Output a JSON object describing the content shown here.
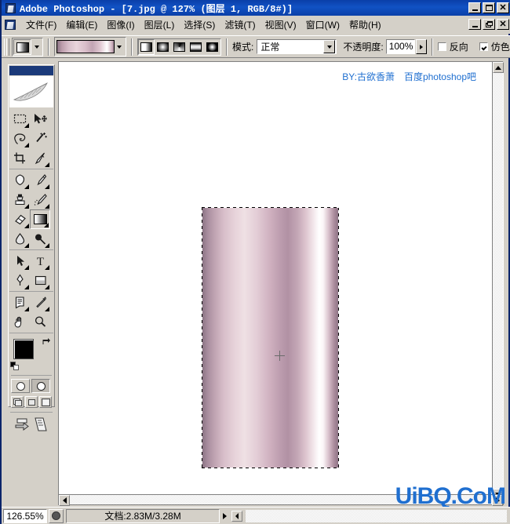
{
  "window": {
    "app_title": "Adobe Photoshop - [7.jpg @ 127% (图层 1, RGB/8#)]",
    "minimize_label": "_",
    "maximize_label": "□",
    "close_label": "✕",
    "doc_minimize_label": "_",
    "doc_restore_label": "❐",
    "doc_close_label": "✕",
    "app_icon": "photoshop-icon",
    "doc_icon": "document-icon"
  },
  "menubar": {
    "items": [
      {
        "label": "文件(F)",
        "name": "menu-file"
      },
      {
        "label": "编辑(E)",
        "name": "menu-edit"
      },
      {
        "label": "图像(I)",
        "name": "menu-image"
      },
      {
        "label": "图层(L)",
        "name": "menu-layer"
      },
      {
        "label": "选择(S)",
        "name": "menu-select"
      },
      {
        "label": "滤镜(T)",
        "name": "menu-filter"
      },
      {
        "label": "视图(V)",
        "name": "menu-view"
      },
      {
        "label": "窗口(W)",
        "name": "menu-window"
      },
      {
        "label": "帮助(H)",
        "name": "menu-help"
      }
    ]
  },
  "options_bar": {
    "tool_preset_icon": "gradient-tool-icon",
    "gradient_picker_label": "gradient-preview",
    "gradient_types": [
      {
        "name": "linear-gradient-button",
        "label": "线性渐变",
        "selected": true
      },
      {
        "name": "radial-gradient-button",
        "label": "径向渐变",
        "selected": false
      },
      {
        "name": "angle-gradient-button",
        "label": "角度渐变",
        "selected": false
      },
      {
        "name": "reflected-gradient-button",
        "label": "对称渐变",
        "selected": false
      },
      {
        "name": "diamond-gradient-button",
        "label": "菱形渐变",
        "selected": false
      }
    ],
    "mode_label": "模式:",
    "mode_value": "正常",
    "opacity_label": "不透明度:",
    "opacity_value": "100%",
    "reverse_label": "反向",
    "reverse_checked": false,
    "dither_label": "仿色",
    "dither_checked": true
  },
  "tools": {
    "groups": [
      {
        "rows": [
          {
            "cells": [
              {
                "name": "tool-marquee",
                "label": "矩形选框工具",
                "icon": "marquee-icon",
                "has_flyout": true,
                "selected": false
              },
              {
                "name": "tool-move",
                "label": "移动工具",
                "icon": "move-icon",
                "has_flyout": false,
                "selected": false
              }
            ]
          },
          {
            "cells": [
              {
                "name": "tool-lasso",
                "label": "套索工具",
                "icon": "lasso-icon",
                "has_flyout": true,
                "selected": false
              },
              {
                "name": "tool-magic-wand",
                "label": "魔棒工具",
                "icon": "magic-wand-icon",
                "has_flyout": false,
                "selected": false
              }
            ]
          },
          {
            "cells": [
              {
                "name": "tool-crop",
                "label": "裁切工具",
                "icon": "crop-icon",
                "has_flyout": false,
                "selected": false
              },
              {
                "name": "tool-slice",
                "label": "切片工具",
                "icon": "slice-icon",
                "has_flyout": true,
                "selected": false
              }
            ]
          }
        ]
      },
      {
        "rows": [
          {
            "cells": [
              {
                "name": "tool-healing-brush",
                "label": "修复画笔工具",
                "icon": "healing-brush-icon",
                "has_flyout": true,
                "selected": false
              },
              {
                "name": "tool-brush",
                "label": "画笔工具",
                "icon": "brush-icon",
                "has_flyout": true,
                "selected": false
              }
            ]
          },
          {
            "cells": [
              {
                "name": "tool-clone-stamp",
                "label": "仿制图章工具",
                "icon": "clone-stamp-icon",
                "has_flyout": true,
                "selected": false
              },
              {
                "name": "tool-history-brush",
                "label": "历史记录画笔工具",
                "icon": "history-brush-icon",
                "has_flyout": true,
                "selected": false
              }
            ]
          },
          {
            "cells": [
              {
                "name": "tool-eraser",
                "label": "橡皮擦工具",
                "icon": "eraser-icon",
                "has_flyout": true,
                "selected": false
              },
              {
                "name": "tool-gradient",
                "label": "渐变工具",
                "icon": "gradient-icon",
                "has_flyout": true,
                "selected": true
              }
            ]
          },
          {
            "cells": [
              {
                "name": "tool-blur",
                "label": "模糊工具",
                "icon": "blur-drop-icon",
                "has_flyout": true,
                "selected": false
              },
              {
                "name": "tool-dodge",
                "label": "减淡工具",
                "icon": "dodge-icon",
                "has_flyout": true,
                "selected": false
              }
            ]
          }
        ]
      },
      {
        "rows": [
          {
            "cells": [
              {
                "name": "tool-path-selection",
                "label": "路径选择工具",
                "icon": "path-selection-arrow-icon",
                "has_flyout": true,
                "selected": false
              },
              {
                "name": "tool-type",
                "label": "文字工具",
                "icon": "type-t-icon",
                "has_flyout": true,
                "selected": false
              }
            ]
          },
          {
            "cells": [
              {
                "name": "tool-pen",
                "label": "钢笔工具",
                "icon": "pen-icon",
                "has_flyout": true,
                "selected": false
              },
              {
                "name": "tool-shape",
                "label": "矩形工具",
                "icon": "rectangle-shape-icon",
                "has_flyout": true,
                "selected": false
              }
            ]
          }
        ]
      },
      {
        "rows": [
          {
            "cells": [
              {
                "name": "tool-notes",
                "label": "注释工具",
                "icon": "notes-icon",
                "has_flyout": true,
                "selected": false
              },
              {
                "name": "tool-eyedropper",
                "label": "吸管工具",
                "icon": "eyedropper-icon",
                "has_flyout": true,
                "selected": false
              }
            ]
          },
          {
            "cells": [
              {
                "name": "tool-hand",
                "label": "抓手工具",
                "icon": "hand-icon",
                "has_flyout": false,
                "selected": false
              },
              {
                "name": "tool-zoom",
                "label": "缩放工具",
                "icon": "magnifier-icon",
                "has_flyout": false,
                "selected": false
              }
            ]
          }
        ]
      }
    ],
    "foreground_color": "#000000",
    "background_color": "#ffffff",
    "swap_icon": "swap-colors-icon",
    "default_colors_icon": "default-colors-icon",
    "quickmask": [
      {
        "name": "standard-mode-button",
        "label": "以标准模式编辑",
        "selected": false
      },
      {
        "name": "quick-mask-mode-button",
        "label": "以快速蒙版模式编辑",
        "selected": true
      }
    ],
    "screen_modes": [
      {
        "name": "standard-screen-mode-button",
        "label": "标准屏幕模式",
        "selected": true
      },
      {
        "name": "full-screen-menubar-button",
        "label": "带有菜单栏的全屏模式",
        "selected": false
      },
      {
        "name": "full-screen-button",
        "label": "全屏模式",
        "selected": false
      }
    ],
    "jump_to": {
      "name": "jump-to-imageready-button",
      "label": "转到 ImageReady"
    }
  },
  "document": {
    "watermark_top": "BY:古欲香萧　百度photoshop吧",
    "watermark_bottom": "UiBQ.CoM",
    "artwork_alt": "metallic-pink-gradient-selection",
    "cursor": "crosshair-cursor"
  },
  "statusbar": {
    "zoom_value": "126.55%",
    "preview_icon": "preview-proxy-icon",
    "doc_info": "文档:2.83M/3.28M",
    "arrow_icon": "status-arrow-icon",
    "resize_icon": "status-popup-icon"
  },
  "colors": {
    "titlebar_start": "#0a3fa8",
    "titlebar_end": "#1152c4",
    "chrome": "#d4d0c8",
    "watermark_blue": "#1f6fd0",
    "gradient_left": "#8c7585",
    "gradient_light": "#efe0e4",
    "gradient_mid": "#b191a4",
    "gradient_highlight": "#ffffff",
    "gradient_right": "#8d7486"
  }
}
